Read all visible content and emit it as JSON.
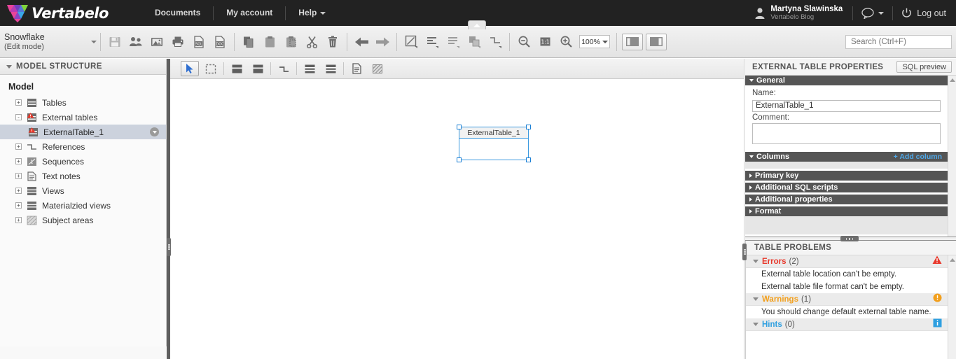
{
  "header": {
    "brand": "Vertabelo",
    "nav": [
      {
        "label": "Documents",
        "icon": "documents-link"
      },
      {
        "label": "My account",
        "icon": "account-link"
      },
      {
        "label": "Help",
        "icon": "help-link"
      }
    ],
    "user": {
      "name": "Martyna Slawinska",
      "org": "Vertabelo Blog",
      "icon": "user-avatar-icon"
    },
    "chat_icon": "chat-bubble-icon",
    "logout": {
      "label": "Log out",
      "icon": "power-icon"
    }
  },
  "toolbar": {
    "model_name": "Snowflake",
    "model_mode": "(Edit mode)",
    "zoom_level": "100%",
    "buttons": [
      {
        "name": "save-icon",
        "title": "Save"
      },
      {
        "name": "share-icon",
        "title": "Share"
      },
      {
        "name": "export-image-icon",
        "title": "Export to image"
      },
      {
        "name": "print-icon",
        "title": "Print"
      },
      {
        "name": "export-sql-icon",
        "title": "Generate SQL"
      },
      {
        "name": "export-doc-icon",
        "title": "Generate documentation"
      },
      {
        "name": "copy-icon",
        "title": "Copy"
      },
      {
        "name": "paste-icon",
        "title": "Paste"
      },
      {
        "name": "paste-special-icon",
        "title": "Paste special"
      },
      {
        "name": "cut-icon",
        "title": "Cut"
      },
      {
        "name": "delete-icon",
        "title": "Delete"
      },
      {
        "name": "undo-icon",
        "title": "Undo"
      },
      {
        "name": "redo-icon",
        "title": "Redo"
      },
      {
        "name": "edit-style-icon",
        "title": "Edit style"
      },
      {
        "name": "align-left-icon",
        "title": "Align"
      },
      {
        "name": "distribute-icon",
        "title": "Distribute"
      },
      {
        "name": "arrange-icon",
        "title": "Arrange"
      },
      {
        "name": "reference-style-icon",
        "title": "Reference style"
      },
      {
        "name": "zoom-out-icon",
        "title": "Zoom out"
      },
      {
        "name": "zoom-actual-icon",
        "title": "Zoom 1:1"
      },
      {
        "name": "zoom-in-icon",
        "title": "Zoom in"
      }
    ],
    "panel_toggle_left": "toggle-left-panel",
    "panel_toggle_right": "toggle-right-panel",
    "collapse_toolbar": "collapse-toolbar-tab"
  },
  "search": {
    "placeholder": "Search (Ctrl+F)",
    "value": ""
  },
  "sidebar": {
    "title": "MODEL STRUCTURE",
    "root": "Model",
    "items": [
      {
        "label": "Tables",
        "icon": "table-icon",
        "expander": "+",
        "selected": false,
        "warning": false
      },
      {
        "label": "External tables",
        "icon": "external-table-icon",
        "expander": "-",
        "selected": false,
        "warning": true
      },
      {
        "label": "ExternalTable_1",
        "icon": "external-table-icon",
        "expander": "",
        "selected": true,
        "warning": true
      },
      {
        "label": "References",
        "icon": "reference-icon",
        "expander": "+",
        "selected": false,
        "warning": false
      },
      {
        "label": "Sequences",
        "icon": "sequence-icon",
        "expander": "+",
        "selected": false,
        "warning": false
      },
      {
        "label": "Text notes",
        "icon": "text-note-icon",
        "expander": "+",
        "selected": false,
        "warning": false
      },
      {
        "label": "Views",
        "icon": "view-icon",
        "expander": "+",
        "selected": false,
        "warning": false
      },
      {
        "label": "Materialzied views",
        "icon": "materialized-view-icon",
        "expander": "+",
        "selected": false,
        "warning": false
      },
      {
        "label": "Subject areas",
        "icon": "subject-area-icon",
        "expander": "+",
        "selected": false,
        "warning": false
      }
    ]
  },
  "canvas": {
    "tools": [
      {
        "name": "pointer-tool",
        "active": true
      },
      {
        "name": "marquee-select-tool",
        "active": false
      },
      {
        "name": "add-table-tool",
        "active": false
      },
      {
        "name": "add-external-table-tool",
        "active": false
      },
      {
        "name": "add-reference-tool",
        "active": false
      },
      {
        "name": "add-view-tool",
        "active": false
      },
      {
        "name": "add-materialized-view-tool",
        "active": false
      },
      {
        "name": "add-text-note-tool",
        "active": false
      },
      {
        "name": "add-subject-area-tool",
        "active": false
      }
    ],
    "shape": {
      "title": "ExternalTable_1",
      "selected": true
    }
  },
  "properties": {
    "title": "EXTERNAL TABLE PROPERTIES",
    "sql_preview_label": "SQL preview",
    "general": {
      "section_label": "General",
      "name_label": "Name:",
      "name_value": "ExternalTable_1",
      "comment_label": "Comment:",
      "comment_value": ""
    },
    "sections": [
      {
        "label": "Columns",
        "expanded": true,
        "action": "+ Add column"
      },
      {
        "label": "Primary key",
        "expanded": false,
        "action": ""
      },
      {
        "label": "Additional SQL scripts",
        "expanded": false,
        "action": ""
      },
      {
        "label": "Additional properties",
        "expanded": false,
        "action": ""
      },
      {
        "label": "Format",
        "expanded": false,
        "action": ""
      }
    ]
  },
  "problems": {
    "title": "TABLE PROBLEMS",
    "groups": [
      {
        "label": "Errors",
        "count": "(2)",
        "color": "#e8382b",
        "badge": "error-badge-icon",
        "items": [
          "External table location can't be empty.",
          "External table file format can't be empty."
        ]
      },
      {
        "label": "Warnings",
        "count": "(1)",
        "color": "#f29f1c",
        "badge": "warning-badge-icon",
        "items": [
          "You should change default external table name."
        ]
      },
      {
        "label": "Hints",
        "count": "(0)",
        "color": "#2e9fe0",
        "badge": "hint-badge-icon",
        "items": []
      }
    ]
  },
  "colors": {
    "header_bg": "#222222",
    "accent_blue": "#4ea8e8",
    "error_red": "#e8382b",
    "warning_orange": "#f29f1c",
    "hint_blue": "#2e9fe0",
    "selection_blue": "#3c9ae0"
  }
}
